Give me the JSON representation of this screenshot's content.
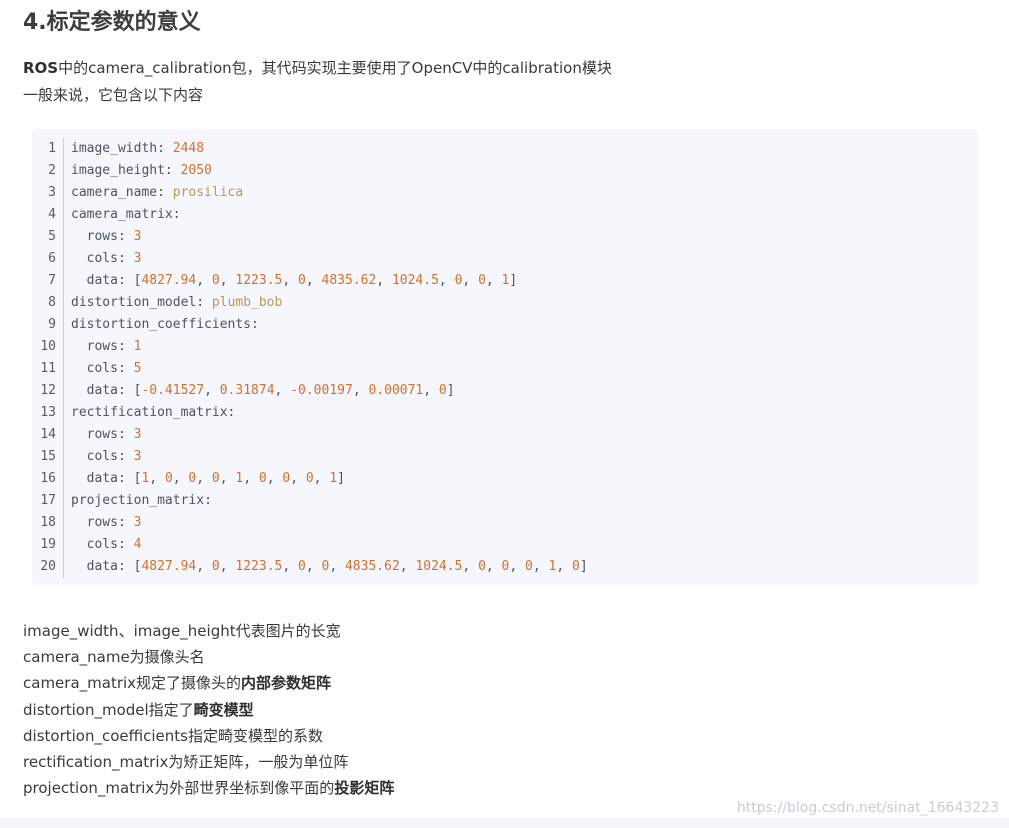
{
  "heading": "4.标定参数的意义",
  "intro": {
    "line1_bold": "ROS",
    "line1_rest": "中的camera_calibration包，其代码实现主要使用了OpenCV中的calibration模块",
    "line2": "一般来说，它包含以下内容"
  },
  "code": {
    "colors": {
      "key": "#4c5363",
      "number": "#d0702c",
      "string": "#b69b54",
      "background": "#f5f7fd"
    },
    "lines": [
      {
        "n": "1",
        "tokens": [
          {
            "t": "image_width",
            "k": "key"
          },
          {
            "t": ": ",
            "k": "pun"
          },
          {
            "t": "2448",
            "k": "num"
          }
        ]
      },
      {
        "n": "2",
        "tokens": [
          {
            "t": "image_height",
            "k": "key"
          },
          {
            "t": ": ",
            "k": "pun"
          },
          {
            "t": "2050",
            "k": "num"
          }
        ]
      },
      {
        "n": "3",
        "tokens": [
          {
            "t": "camera_name",
            "k": "key"
          },
          {
            "t": ": ",
            "k": "pun"
          },
          {
            "t": "prosilica",
            "k": "str"
          }
        ]
      },
      {
        "n": "4",
        "tokens": [
          {
            "t": "camera_matrix",
            "k": "key"
          },
          {
            "t": ":",
            "k": "pun"
          }
        ]
      },
      {
        "n": "5",
        "tokens": [
          {
            "t": "  rows",
            "k": "key"
          },
          {
            "t": ": ",
            "k": "pun"
          },
          {
            "t": "3",
            "k": "num"
          }
        ]
      },
      {
        "n": "6",
        "tokens": [
          {
            "t": "  cols",
            "k": "key"
          },
          {
            "t": ": ",
            "k": "pun"
          },
          {
            "t": "3",
            "k": "num"
          }
        ]
      },
      {
        "n": "7",
        "tokens": [
          {
            "t": "  data",
            "k": "key"
          },
          {
            "t": ": [",
            "k": "pun"
          },
          {
            "t": "4827.94",
            "k": "num"
          },
          {
            "t": ", ",
            "k": "pun"
          },
          {
            "t": "0",
            "k": "num"
          },
          {
            "t": ", ",
            "k": "pun"
          },
          {
            "t": "1223.5",
            "k": "num"
          },
          {
            "t": ", ",
            "k": "pun"
          },
          {
            "t": "0",
            "k": "num"
          },
          {
            "t": ", ",
            "k": "pun"
          },
          {
            "t": "4835.62",
            "k": "num"
          },
          {
            "t": ", ",
            "k": "pun"
          },
          {
            "t": "1024.5",
            "k": "num"
          },
          {
            "t": ", ",
            "k": "pun"
          },
          {
            "t": "0",
            "k": "num"
          },
          {
            "t": ", ",
            "k": "pun"
          },
          {
            "t": "0",
            "k": "num"
          },
          {
            "t": ", ",
            "k": "pun"
          },
          {
            "t": "1",
            "k": "num"
          },
          {
            "t": "]",
            "k": "pun"
          }
        ]
      },
      {
        "n": "8",
        "tokens": [
          {
            "t": "distortion_model",
            "k": "key"
          },
          {
            "t": ": ",
            "k": "pun"
          },
          {
            "t": "plumb_bob",
            "k": "str"
          }
        ]
      },
      {
        "n": "9",
        "tokens": [
          {
            "t": "distortion_coefficients",
            "k": "key"
          },
          {
            "t": ":",
            "k": "pun"
          }
        ]
      },
      {
        "n": "10",
        "tokens": [
          {
            "t": "  rows",
            "k": "key"
          },
          {
            "t": ": ",
            "k": "pun"
          },
          {
            "t": "1",
            "k": "num"
          }
        ]
      },
      {
        "n": "11",
        "tokens": [
          {
            "t": "  cols",
            "k": "key"
          },
          {
            "t": ": ",
            "k": "pun"
          },
          {
            "t": "5",
            "k": "num"
          }
        ]
      },
      {
        "n": "12",
        "tokens": [
          {
            "t": "  data",
            "k": "key"
          },
          {
            "t": ": [",
            "k": "pun"
          },
          {
            "t": "-0.41527",
            "k": "num"
          },
          {
            "t": ", ",
            "k": "pun"
          },
          {
            "t": "0.31874",
            "k": "num"
          },
          {
            "t": ", ",
            "k": "pun"
          },
          {
            "t": "-0.00197",
            "k": "num"
          },
          {
            "t": ", ",
            "k": "pun"
          },
          {
            "t": "0.00071",
            "k": "num"
          },
          {
            "t": ", ",
            "k": "pun"
          },
          {
            "t": "0",
            "k": "num"
          },
          {
            "t": "]",
            "k": "pun"
          }
        ]
      },
      {
        "n": "13",
        "tokens": [
          {
            "t": "rectification_matrix",
            "k": "key"
          },
          {
            "t": ":",
            "k": "pun"
          }
        ]
      },
      {
        "n": "14",
        "tokens": [
          {
            "t": "  rows",
            "k": "key"
          },
          {
            "t": ": ",
            "k": "pun"
          },
          {
            "t": "3",
            "k": "num"
          }
        ]
      },
      {
        "n": "15",
        "tokens": [
          {
            "t": "  cols",
            "k": "key"
          },
          {
            "t": ": ",
            "k": "pun"
          },
          {
            "t": "3",
            "k": "num"
          }
        ]
      },
      {
        "n": "16",
        "tokens": [
          {
            "t": "  data",
            "k": "key"
          },
          {
            "t": ": [",
            "k": "pun"
          },
          {
            "t": "1",
            "k": "num"
          },
          {
            "t": ", ",
            "k": "pun"
          },
          {
            "t": "0",
            "k": "num"
          },
          {
            "t": ", ",
            "k": "pun"
          },
          {
            "t": "0",
            "k": "num"
          },
          {
            "t": ", ",
            "k": "pun"
          },
          {
            "t": "0",
            "k": "num"
          },
          {
            "t": ", ",
            "k": "pun"
          },
          {
            "t": "1",
            "k": "num"
          },
          {
            "t": ", ",
            "k": "pun"
          },
          {
            "t": "0",
            "k": "num"
          },
          {
            "t": ", ",
            "k": "pun"
          },
          {
            "t": "0",
            "k": "num"
          },
          {
            "t": ", ",
            "k": "pun"
          },
          {
            "t": "0",
            "k": "num"
          },
          {
            "t": ", ",
            "k": "pun"
          },
          {
            "t": "1",
            "k": "num"
          },
          {
            "t": "]",
            "k": "pun"
          }
        ]
      },
      {
        "n": "17",
        "tokens": [
          {
            "t": "projection_matrix",
            "k": "key"
          },
          {
            "t": ":",
            "k": "pun"
          }
        ]
      },
      {
        "n": "18",
        "tokens": [
          {
            "t": "  rows",
            "k": "key"
          },
          {
            "t": ": ",
            "k": "pun"
          },
          {
            "t": "3",
            "k": "num"
          }
        ]
      },
      {
        "n": "19",
        "tokens": [
          {
            "t": "  cols",
            "k": "key"
          },
          {
            "t": ": ",
            "k": "pun"
          },
          {
            "t": "4",
            "k": "num"
          }
        ]
      },
      {
        "n": "20",
        "tokens": [
          {
            "t": "  data",
            "k": "key"
          },
          {
            "t": ": [",
            "k": "pun"
          },
          {
            "t": "4827.94",
            "k": "num"
          },
          {
            "t": ", ",
            "k": "pun"
          },
          {
            "t": "0",
            "k": "num"
          },
          {
            "t": ", ",
            "k": "pun"
          },
          {
            "t": "1223.5",
            "k": "num"
          },
          {
            "t": ", ",
            "k": "pun"
          },
          {
            "t": "0",
            "k": "num"
          },
          {
            "t": ", ",
            "k": "pun"
          },
          {
            "t": "0",
            "k": "num"
          },
          {
            "t": ", ",
            "k": "pun"
          },
          {
            "t": "4835.62",
            "k": "num"
          },
          {
            "t": ", ",
            "k": "pun"
          },
          {
            "t": "1024.5",
            "k": "num"
          },
          {
            "t": ", ",
            "k": "pun"
          },
          {
            "t": "0",
            "k": "num"
          },
          {
            "t": ", ",
            "k": "pun"
          },
          {
            "t": "0",
            "k": "num"
          },
          {
            "t": ", ",
            "k": "pun"
          },
          {
            "t": "0",
            "k": "num"
          },
          {
            "t": ", ",
            "k": "pun"
          },
          {
            "t": "1",
            "k": "num"
          },
          {
            "t": ", ",
            "k": "pun"
          },
          {
            "t": "0",
            "k": "num"
          },
          {
            "t": "]",
            "k": "pun"
          }
        ]
      }
    ]
  },
  "notes": [
    {
      "text": "image_width、image_height代表图片的长宽",
      "bold": ""
    },
    {
      "text": "camera_name为摄像头名",
      "bold": ""
    },
    {
      "text": "camera_matrix规定了摄像头的",
      "bold": "内部参数矩阵"
    },
    {
      "text": "distortion_model指定了",
      "bold": "畸变模型"
    },
    {
      "text": "distortion_coefficients指定畸变模型的系数",
      "bold": ""
    },
    {
      "text": "rectification_matrix为矫正矩阵，一般为单位阵",
      "bold": ""
    },
    {
      "text": "projection_matrix为外部世界坐标到像平面的",
      "bold": "投影矩阵"
    }
  ],
  "watermark": "https://blog.csdn.net/sinat_16643223"
}
